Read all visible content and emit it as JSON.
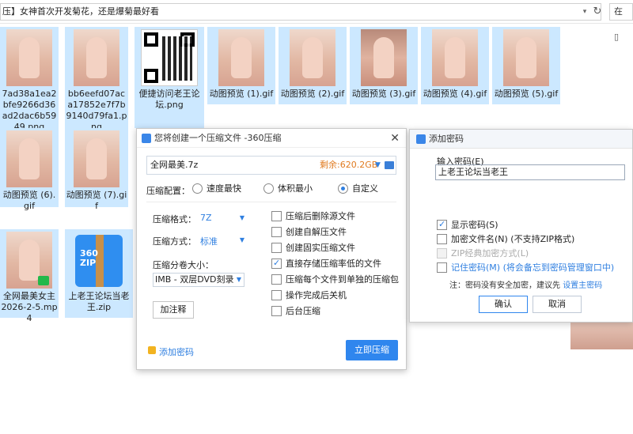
{
  "address_bar": {
    "path_text": "压】女神首次开发菊花，还是爆菊最好看",
    "search_label": "在"
  },
  "files": [
    {
      "name": "7ad38a1ea2bfe9266d36ad2dac6b5949.png",
      "kind": "photo"
    },
    {
      "name": "bb6eefd07aca17852e7f7b9140d79fa1.png",
      "kind": "photo"
    },
    {
      "name": "便捷访问老王论坛.png",
      "kind": "qr"
    },
    {
      "name": "动图预览 (1).gif",
      "kind": "photo"
    },
    {
      "name": "动图预览 (2).gif",
      "kind": "photo"
    },
    {
      "name": "动图预览 (3).gif",
      "kind": "photo"
    },
    {
      "name": "动图预览 (4).gif",
      "kind": "photo"
    },
    {
      "name": "动图预览 (5).gif",
      "kind": "photo"
    },
    {
      "name": "动图预览 (6).gif",
      "kind": "photo"
    },
    {
      "name": "动图预览 (7).gif",
      "kind": "photo"
    },
    {
      "name": "全网最美女主2026-2-5.mp4",
      "kind": "video"
    },
    {
      "name": "上老王论坛当老王.zip",
      "kind": "zip"
    }
  ],
  "compress_dialog": {
    "title": "您将创建一个压缩文件 -360压缩",
    "file_name": "全网最美.7z",
    "space_left": "剩余:620.2GB",
    "config_label": "压缩配置：",
    "options": [
      "速度最快",
      "体积最小",
      "自定义"
    ],
    "selected_option": "自定义",
    "format_label": "压缩格式：",
    "format_value": "7Z",
    "method_label": "压缩方式：",
    "method_value": "标准",
    "volume_label": "压缩分卷大小：",
    "volume_value": "IMB - 双层DVD刻录",
    "note_button": "加注释",
    "checkboxes": [
      {
        "label": "压缩后删除源文件",
        "checked": false
      },
      {
        "label": "创建自解压文件",
        "checked": false
      },
      {
        "label": "创建固实压缩文件",
        "checked": false
      },
      {
        "label": "直接存储压缩率低的文件",
        "checked": true
      },
      {
        "label": "压缩每个文件到单独的压缩包",
        "checked": false
      },
      {
        "label": "操作完成后关机",
        "checked": false
      },
      {
        "label": "后台压缩",
        "checked": false
      }
    ],
    "add_password_link": "添加密码",
    "compress_button": "立即压缩"
  },
  "password_panel": {
    "title": "添加密码",
    "input_label": "输入密码(E)",
    "password_value": "上老王论坛当老王",
    "show_password": "显示密码(S)",
    "encrypt_names": "加密文件名(N) (不支持ZIP格式)",
    "zip_classic": "ZIP经典加密方式(L)",
    "remember_prefix": "记住密码(M)",
    "remember_link": "(将会备忘到密码管理窗口中)",
    "note_prefix": "注：密码没有安全加密，建议先",
    "note_link": "设置主密码",
    "ok_button": "确认",
    "cancel_button": "取消"
  },
  "colors": {
    "accent": "#2f86ee",
    "selection": "#cce8ff",
    "space_left": "#e07a1f"
  }
}
